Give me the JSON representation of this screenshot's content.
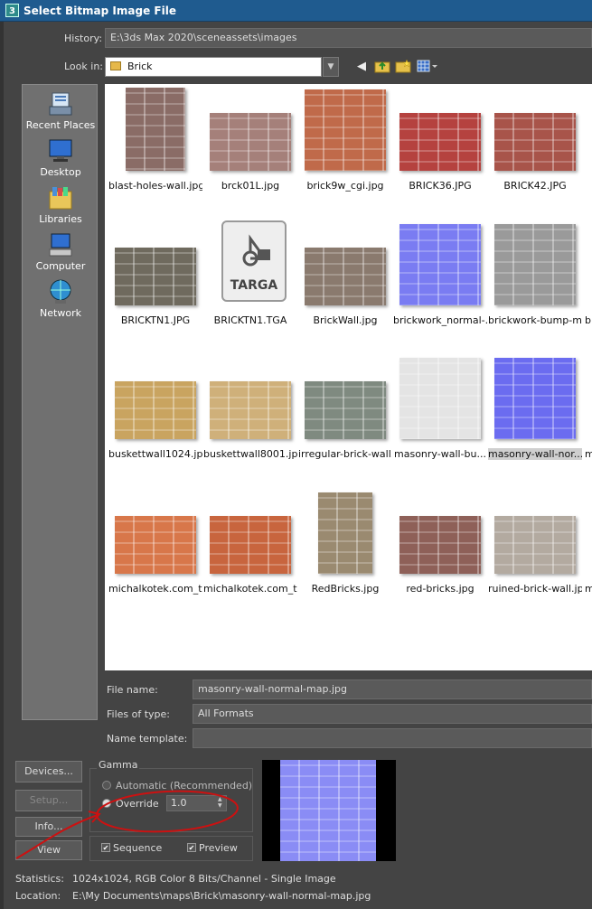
{
  "window": {
    "title": "Select Bitmap Image File",
    "app_icon": "3"
  },
  "history": {
    "label": "History:",
    "value": "E:\\3ds Max 2020\\sceneassets\\images"
  },
  "lookin": {
    "label": "Look in:",
    "value": "Brick"
  },
  "toolbar_icons": [
    "back-arrow-icon",
    "up-folder-icon",
    "new-folder-icon",
    "view-menu-icon"
  ],
  "places": [
    {
      "label": "Recent Places",
      "icon": "recent-places-icon"
    },
    {
      "label": "Desktop",
      "icon": "desktop-icon"
    },
    {
      "label": "Libraries",
      "icon": "libraries-icon"
    },
    {
      "label": "Computer",
      "icon": "computer-icon"
    },
    {
      "label": "Network",
      "icon": "network-icon"
    }
  ],
  "files": [
    {
      "name": "blast-holes-wall.jpg",
      "color": "#8a6c66"
    },
    {
      "name": "brck01L.jpg",
      "color": "#a5807a"
    },
    {
      "name": "brick9w_cgi.jpg",
      "color": "#c06a4a"
    },
    {
      "name": "BRICK36.JPG",
      "color": "#b5423f"
    },
    {
      "name": "BRICK42.JPG",
      "color": "#a8544a"
    },
    {
      "name": "BRICKTN1.JPG",
      "color": "#6f6a5e"
    },
    {
      "name": "BRICKTN1.TGA",
      "color": "#e8e8e8",
      "tga": "TARGA"
    },
    {
      "name": "BrickWall.jpg",
      "color": "#8a7a6e"
    },
    {
      "name": "brickwork_normal-...",
      "color": "#7a7cf2"
    },
    {
      "name": "brickwork-bump-m...",
      "color": "#9a9a9a"
    },
    {
      "name": "buskettwall1024.jpg",
      "color": "#c9a460"
    },
    {
      "name": "buskettwall8001.jpg",
      "color": "#cfb07a"
    },
    {
      "name": "irregular-brick-wall...",
      "color": "#7f8a80"
    },
    {
      "name": "masonry-wall-bu...",
      "color": "#e4e4e4"
    },
    {
      "name": "masonry-wall-nor...",
      "color": "#6b6cf0",
      "selected": true
    },
    {
      "name": "michalkotek.com_t...",
      "color": "#d8774a"
    },
    {
      "name": "michalkotek.com_t...",
      "color": "#c8653e"
    },
    {
      "name": "RedBricks.jpg",
      "color": "#9a8a70"
    },
    {
      "name": "red-bricks.jpg",
      "color": "#8e6058"
    },
    {
      "name": "ruined-brick-wall.jpg",
      "color": "#b3aaa0"
    }
  ],
  "partial_labels": [
    "b",
    "m",
    "m"
  ],
  "filename": {
    "label": "File name:",
    "value": "masonry-wall-normal-map.jpg"
  },
  "filetype": {
    "label": "Files of type:",
    "value": "All Formats"
  },
  "nametemplate": {
    "label": "Name template:",
    "value": ""
  },
  "buttons": {
    "devices": "Devices...",
    "setup": "Setup...",
    "info": "Info...",
    "view": "View"
  },
  "gamma": {
    "title": "Gamma",
    "automatic": "Automatic (Recommended)",
    "override": "Override",
    "override_value": "1.0"
  },
  "options": {
    "sequence": "Sequence",
    "preview": "Preview"
  },
  "statistics": {
    "label": "Statistics:",
    "value": "1024x1024, RGB Color 8 Bits/Channel - Single Image"
  },
  "location": {
    "label": "Location:",
    "value": "E:\\My Documents\\maps\\Brick\\masonry-wall-normal-map.jpg"
  },
  "colors": {
    "title_bar": "#1f5b8f",
    "annotation": "#cc1111",
    "normal_map": "#8a8cf5"
  }
}
